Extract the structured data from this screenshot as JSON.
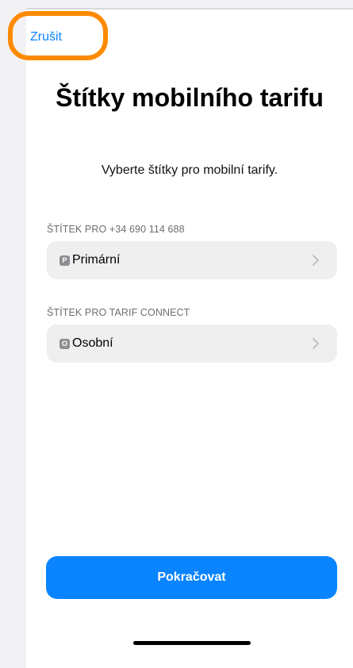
{
  "header": {
    "cancel_label": "Zrušit"
  },
  "title": "Štítky mobilního tarifu",
  "subtitle": "Vyberte štítky pro mobilní tarify.",
  "sections": [
    {
      "label": "ŠTÍTEK PRO +34 690 114 688",
      "tag_letter": "P",
      "value": "Primární"
    },
    {
      "label": "ŠTÍTEK PRO TARIF CONNECT",
      "tag_letter": "O",
      "value": "Osobní"
    }
  ],
  "continue_label": "Pokračovat",
  "colors": {
    "accent": "#0a84ff",
    "highlight": "#ff8a00"
  },
  "icons": {
    "row_disclosure": "chevron-right-icon"
  }
}
